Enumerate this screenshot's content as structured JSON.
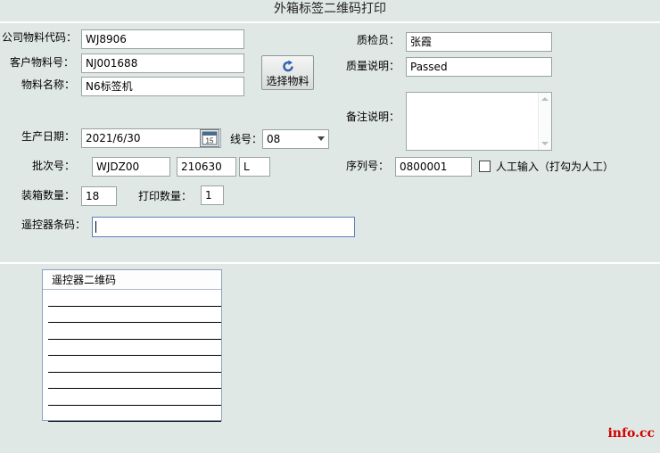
{
  "window": {
    "title": "外箱标签二维码打印"
  },
  "fields": {
    "company_code": {
      "label": "公司物料代码：",
      "value": "WJ8906"
    },
    "customer_no": {
      "label": "客户物料号：",
      "value": "NJ001688"
    },
    "material_name": {
      "label": "物料名称：",
      "value": "N6标签机"
    },
    "inspector": {
      "label": "质检员：",
      "value": "张霞"
    },
    "quality_note": {
      "label": "质量说明：",
      "value": "Passed"
    },
    "remark": {
      "label": "备注说明：",
      "value": ""
    },
    "prod_date": {
      "label": "生产日期：",
      "value": "2021/6/30",
      "calendar_day": "15"
    },
    "line_no": {
      "label": "线号：",
      "value": "08"
    },
    "batch": {
      "label": "批次号：",
      "part1": "WJDZ00",
      "part2": "210630",
      "part3": "L"
    },
    "serial": {
      "label": "序列号：",
      "value": "0800001"
    },
    "manual_input": {
      "label": "人工输入（打勾为人工）",
      "checked": false
    },
    "box_qty": {
      "label": "装箱数量：",
      "value": "18"
    },
    "print_qty": {
      "label": "打印数量：",
      "value": "1"
    },
    "remote_barcode": {
      "label": "遥控器条码：",
      "value": ""
    }
  },
  "buttons": {
    "select_material": "选择物料"
  },
  "grid": {
    "column_header": "遥控器二维码",
    "rows": [
      "",
      "",
      "",
      "",
      "",
      "",
      "",
      ""
    ]
  },
  "watermark": "info.cc",
  "colors": {
    "background": "#dfe8e4",
    "refresh_icon": "#2f5fb0",
    "watermark": "#d40000"
  }
}
